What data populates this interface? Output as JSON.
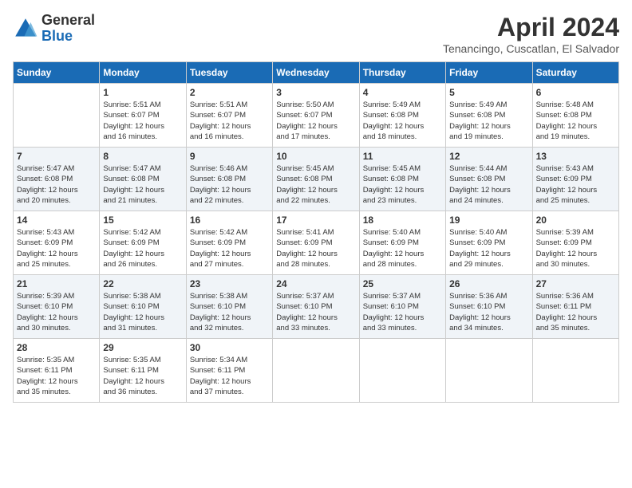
{
  "logo": {
    "general": "General",
    "blue": "Blue"
  },
  "title": "April 2024",
  "location": "Tenancingo, Cuscatlan, El Salvador",
  "days_of_week": [
    "Sunday",
    "Monday",
    "Tuesday",
    "Wednesday",
    "Thursday",
    "Friday",
    "Saturday"
  ],
  "weeks": [
    [
      {
        "day": "",
        "info": ""
      },
      {
        "day": "1",
        "info": "Sunrise: 5:51 AM\nSunset: 6:07 PM\nDaylight: 12 hours\nand 16 minutes."
      },
      {
        "day": "2",
        "info": "Sunrise: 5:51 AM\nSunset: 6:07 PM\nDaylight: 12 hours\nand 16 minutes."
      },
      {
        "day": "3",
        "info": "Sunrise: 5:50 AM\nSunset: 6:07 PM\nDaylight: 12 hours\nand 17 minutes."
      },
      {
        "day": "4",
        "info": "Sunrise: 5:49 AM\nSunset: 6:08 PM\nDaylight: 12 hours\nand 18 minutes."
      },
      {
        "day": "5",
        "info": "Sunrise: 5:49 AM\nSunset: 6:08 PM\nDaylight: 12 hours\nand 19 minutes."
      },
      {
        "day": "6",
        "info": "Sunrise: 5:48 AM\nSunset: 6:08 PM\nDaylight: 12 hours\nand 19 minutes."
      }
    ],
    [
      {
        "day": "7",
        "info": "Sunrise: 5:47 AM\nSunset: 6:08 PM\nDaylight: 12 hours\nand 20 minutes."
      },
      {
        "day": "8",
        "info": "Sunrise: 5:47 AM\nSunset: 6:08 PM\nDaylight: 12 hours\nand 21 minutes."
      },
      {
        "day": "9",
        "info": "Sunrise: 5:46 AM\nSunset: 6:08 PM\nDaylight: 12 hours\nand 22 minutes."
      },
      {
        "day": "10",
        "info": "Sunrise: 5:45 AM\nSunset: 6:08 PM\nDaylight: 12 hours\nand 22 minutes."
      },
      {
        "day": "11",
        "info": "Sunrise: 5:45 AM\nSunset: 6:08 PM\nDaylight: 12 hours\nand 23 minutes."
      },
      {
        "day": "12",
        "info": "Sunrise: 5:44 AM\nSunset: 6:08 PM\nDaylight: 12 hours\nand 24 minutes."
      },
      {
        "day": "13",
        "info": "Sunrise: 5:43 AM\nSunset: 6:09 PM\nDaylight: 12 hours\nand 25 minutes."
      }
    ],
    [
      {
        "day": "14",
        "info": "Sunrise: 5:43 AM\nSunset: 6:09 PM\nDaylight: 12 hours\nand 25 minutes."
      },
      {
        "day": "15",
        "info": "Sunrise: 5:42 AM\nSunset: 6:09 PM\nDaylight: 12 hours\nand 26 minutes."
      },
      {
        "day": "16",
        "info": "Sunrise: 5:42 AM\nSunset: 6:09 PM\nDaylight: 12 hours\nand 27 minutes."
      },
      {
        "day": "17",
        "info": "Sunrise: 5:41 AM\nSunset: 6:09 PM\nDaylight: 12 hours\nand 28 minutes."
      },
      {
        "day": "18",
        "info": "Sunrise: 5:40 AM\nSunset: 6:09 PM\nDaylight: 12 hours\nand 28 minutes."
      },
      {
        "day": "19",
        "info": "Sunrise: 5:40 AM\nSunset: 6:09 PM\nDaylight: 12 hours\nand 29 minutes."
      },
      {
        "day": "20",
        "info": "Sunrise: 5:39 AM\nSunset: 6:09 PM\nDaylight: 12 hours\nand 30 minutes."
      }
    ],
    [
      {
        "day": "21",
        "info": "Sunrise: 5:39 AM\nSunset: 6:10 PM\nDaylight: 12 hours\nand 30 minutes."
      },
      {
        "day": "22",
        "info": "Sunrise: 5:38 AM\nSunset: 6:10 PM\nDaylight: 12 hours\nand 31 minutes."
      },
      {
        "day": "23",
        "info": "Sunrise: 5:38 AM\nSunset: 6:10 PM\nDaylight: 12 hours\nand 32 minutes."
      },
      {
        "day": "24",
        "info": "Sunrise: 5:37 AM\nSunset: 6:10 PM\nDaylight: 12 hours\nand 33 minutes."
      },
      {
        "day": "25",
        "info": "Sunrise: 5:37 AM\nSunset: 6:10 PM\nDaylight: 12 hours\nand 33 minutes."
      },
      {
        "day": "26",
        "info": "Sunrise: 5:36 AM\nSunset: 6:10 PM\nDaylight: 12 hours\nand 34 minutes."
      },
      {
        "day": "27",
        "info": "Sunrise: 5:36 AM\nSunset: 6:11 PM\nDaylight: 12 hours\nand 35 minutes."
      }
    ],
    [
      {
        "day": "28",
        "info": "Sunrise: 5:35 AM\nSunset: 6:11 PM\nDaylight: 12 hours\nand 35 minutes."
      },
      {
        "day": "29",
        "info": "Sunrise: 5:35 AM\nSunset: 6:11 PM\nDaylight: 12 hours\nand 36 minutes."
      },
      {
        "day": "30",
        "info": "Sunrise: 5:34 AM\nSunset: 6:11 PM\nDaylight: 12 hours\nand 37 minutes."
      },
      {
        "day": "",
        "info": ""
      },
      {
        "day": "",
        "info": ""
      },
      {
        "day": "",
        "info": ""
      },
      {
        "day": "",
        "info": ""
      }
    ]
  ]
}
